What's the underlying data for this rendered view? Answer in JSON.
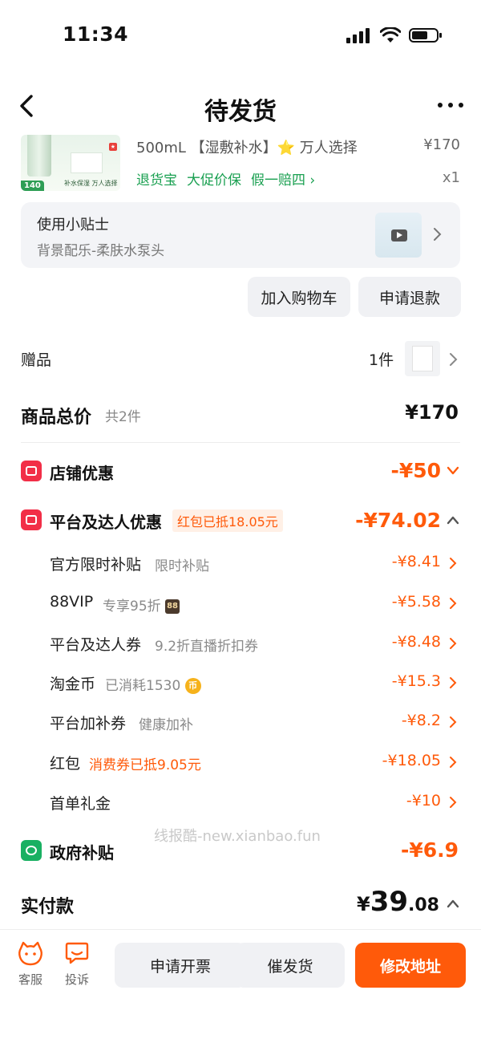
{
  "status_bar": {
    "time": "11:34"
  },
  "header": {
    "title": "待发货"
  },
  "product": {
    "thumb_price": "140",
    "thumb_caption": "补水保湿 万人选择",
    "name": "500mL 【湿敷补水】⭐ 万人选择",
    "price": "¥170",
    "tags": [
      "退货宝",
      "大促价保",
      "假一赔四 ›"
    ],
    "quantity": "x1"
  },
  "tips": {
    "title": "使用小贴士",
    "subtitle": "背景配乐-柔肤水泵头"
  },
  "actions": {
    "add_cart": "加入购物车",
    "refund": "申请退款"
  },
  "gift": {
    "label": "赠品",
    "count": "1件"
  },
  "total": {
    "label": "商品总价",
    "count": "共2件",
    "value": "¥170"
  },
  "shop_discount": {
    "label": "店铺优惠",
    "value": "-¥50"
  },
  "platform_discount": {
    "label": "平台及达人优惠",
    "badge": "红包已抵18.05元",
    "value": "-¥74.02",
    "items": [
      {
        "label": "官方限时补贴",
        "note": "限时补贴",
        "value": "-¥8.41"
      },
      {
        "label": "88VIP",
        "note": "专享95折",
        "badge": "88",
        "value": "-¥5.58"
      },
      {
        "label": "平台及达人券",
        "note": "9.2折直播折扣券",
        "value": "-¥8.48"
      },
      {
        "label": "淘金币",
        "note": "已消耗1530",
        "badge": "币",
        "value": "-¥15.3"
      },
      {
        "label": "平台加补券",
        "note": "健康加补",
        "value": "-¥8.2"
      },
      {
        "label": "红包",
        "note": "消费券已抵9.05元",
        "value": "-¥18.05"
      },
      {
        "label": "首单礼金",
        "note": "",
        "value": "-¥10"
      }
    ]
  },
  "gov_subsidy": {
    "label": "政府补贴",
    "value": "-¥6.9"
  },
  "watermark": "线报酷-new.xianbao.fun",
  "payment": {
    "label": "实付款",
    "yen": "¥",
    "int": "39",
    "dec": ".08"
  },
  "bottom": {
    "service": "客服",
    "complaint": "投诉",
    "invoice": "申请开票",
    "urge": "催发货",
    "change_address": "修改地址"
  },
  "colors": {
    "accent": "#ff5a0a",
    "green": "#1aa051",
    "red_icon": "#f22e47"
  }
}
